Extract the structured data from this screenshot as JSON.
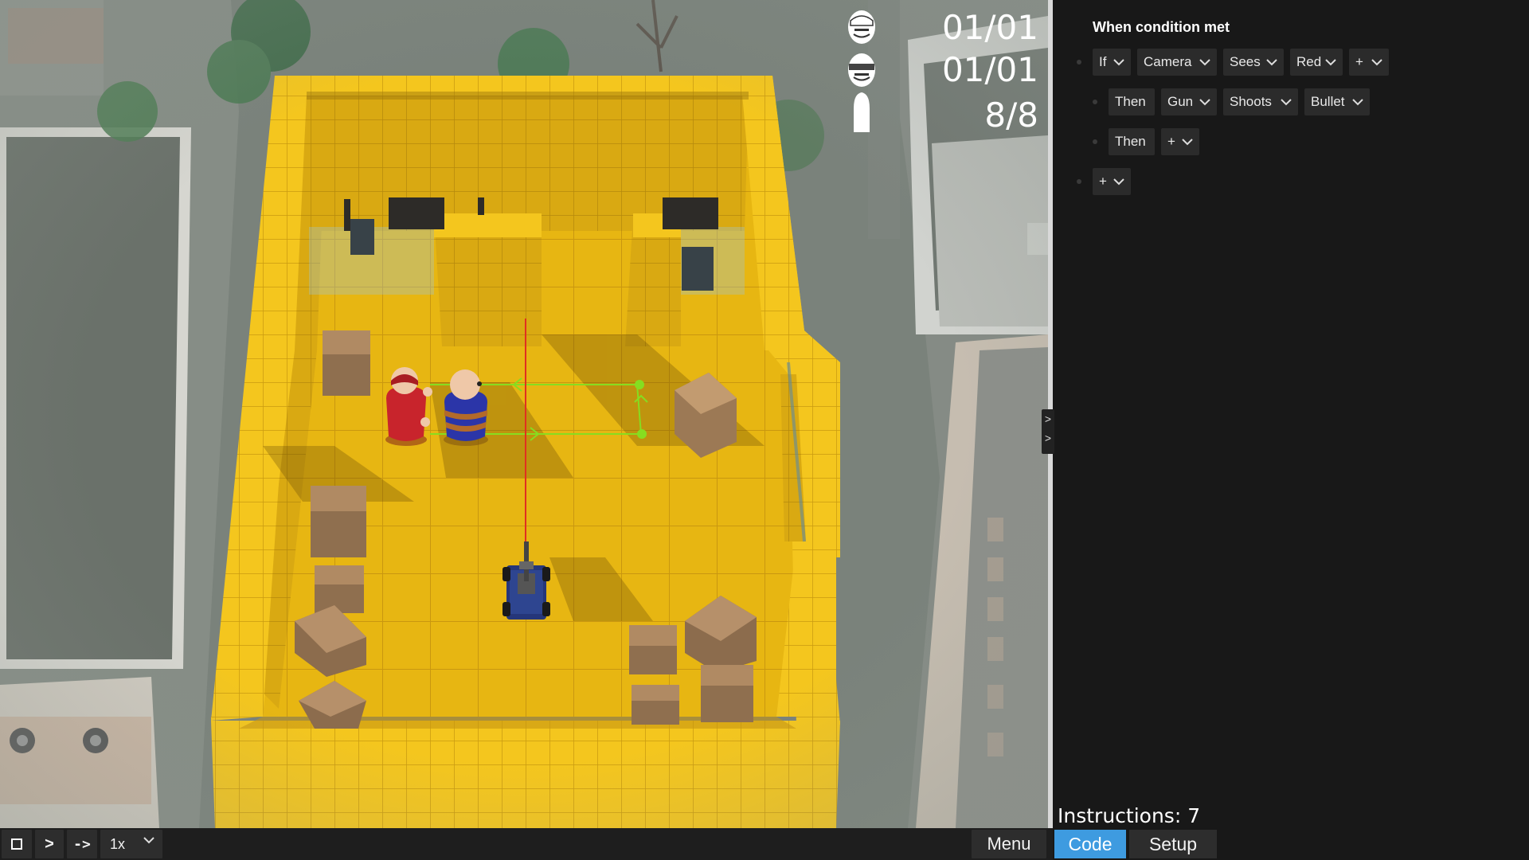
{
  "hud": {
    "targets_counter": "01/01",
    "civilians_counter": "01/01",
    "ammo_counter": "8/8",
    "icons": [
      "enemy-head-icon",
      "civilian-head-icon",
      "bullet-icon"
    ]
  },
  "bottom_bar": {
    "stop_icon": "stop-square-icon",
    "play_label": ">",
    "step_label": "->",
    "speed_value": "1x",
    "menu_label": "Menu"
  },
  "collapse_handle": {
    "chevrons": ">\n>"
  },
  "code_panel": {
    "title": "When condition met",
    "rules": [
      {
        "tokens": [
          "If",
          "Camera",
          "Sees",
          "Red",
          "+"
        ]
      },
      {
        "tokens": [
          "Then",
          "Gun",
          "Shoots",
          "Bullet"
        ]
      },
      {
        "tokens": [
          "Then",
          "+"
        ]
      },
      {
        "tokens": [
          "+"
        ]
      }
    ],
    "instructions": "Instructions: 7",
    "tabs": {
      "code": "Code",
      "setup": "Setup"
    },
    "active_tab": "Code"
  },
  "colors": {
    "wall_yellow": "#f2c21b",
    "floor_yellow": "#e8b712",
    "enemy_red": "#c8242c",
    "civilian_blue": "#2b35a8",
    "active_tab_blue": "#3e9be0",
    "path_green": "#7ddc1f",
    "laser_red": "#e03020"
  }
}
